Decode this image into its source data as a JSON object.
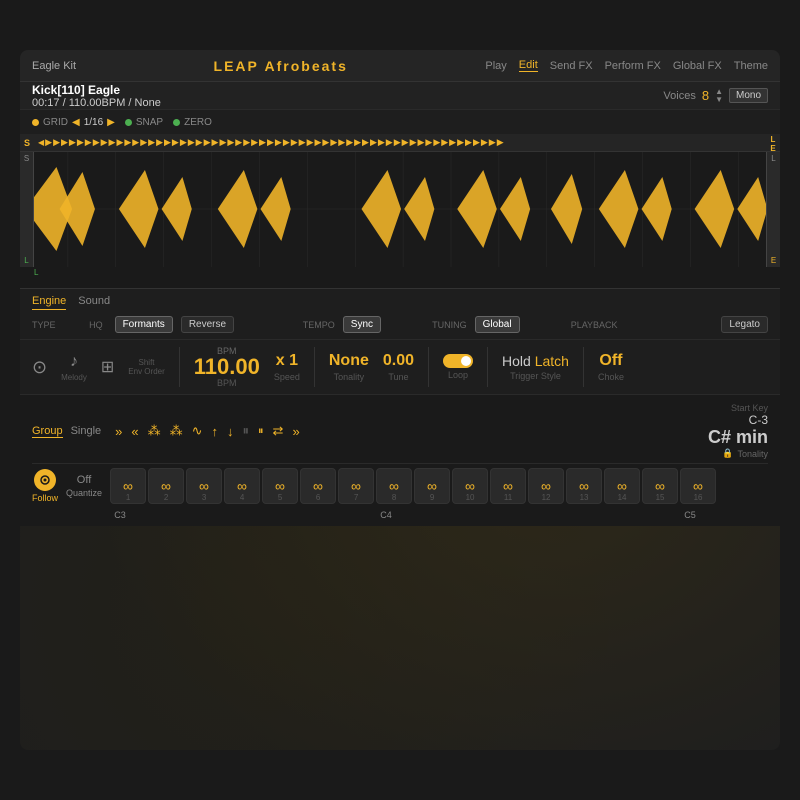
{
  "app": {
    "title_leap": "LEAP",
    "title_preset": "Afrobeats",
    "kit_name": "Eagle Kit",
    "nav_tabs": [
      "Play",
      "Edit",
      "Send FX",
      "Perform FX",
      "Global FX",
      "Theme"
    ],
    "active_tab": "Edit"
  },
  "track": {
    "name": "Kick[110] Eagle",
    "time": "00:17",
    "bpm": "110.00BPM",
    "key": "None",
    "voices_label": "Voices",
    "voices_count": "8",
    "mono_label": "Mono"
  },
  "grid": {
    "grid_label": "GRID",
    "grid_value": "1/16",
    "snap_label": "SNAP",
    "zero_label": "ZERO"
  },
  "timeline": {
    "marker_s": "S",
    "marker_l": "L",
    "marker_e": "E"
  },
  "engine": {
    "tabs": [
      "Engine",
      "Sound"
    ],
    "active_tab": "Engine",
    "type_label": "TYPE",
    "hq_label": "HQ",
    "formants_label": "Formants",
    "reverse_label": "Reverse",
    "tempo_label": "TEMPO",
    "sync_label": "Sync",
    "tuning_label": "TUNING",
    "global_label": "Global",
    "playback_label": "PLAYBACK",
    "legato_label": "Legato"
  },
  "controls": {
    "melody_label": "Melody",
    "shift_label": "Shift",
    "env_order_label": "Env Order",
    "bpm_value": "110.00",
    "bpm_label": "BPM",
    "speed_value": "x 1",
    "speed_label": "Speed",
    "tonality_value": "None",
    "tonality_label": "Tonality",
    "tune_value": "0.00",
    "tune_label": "Tune",
    "loop_label": "Loop",
    "hold_label": "Hold",
    "latch_label": "Latch",
    "trigger_style_label": "Trigger Style",
    "choke_value": "Off",
    "choke_label": "Choke"
  },
  "sequencer": {
    "group_tabs": [
      "Group",
      "Single"
    ],
    "active_tab": "Group",
    "start_key_label": "Start Key",
    "start_key_value": "C-3",
    "tonality_value": "C# min",
    "tonality_label": "Tonality"
  },
  "pads": {
    "follow_label": "Follow",
    "quantize_label": "Quantize",
    "quantize_value": "Off",
    "items": [
      {
        "num": "1",
        "note": "C3",
        "active": false
      },
      {
        "num": "2",
        "note": "",
        "active": false
      },
      {
        "num": "3",
        "note": "",
        "active": false
      },
      {
        "num": "4",
        "note": "",
        "active": false
      },
      {
        "num": "5",
        "note": "",
        "active": false
      },
      {
        "num": "6",
        "note": "",
        "active": false
      },
      {
        "num": "7",
        "note": "",
        "active": false
      },
      {
        "num": "8",
        "note": "C4",
        "active": false
      },
      {
        "num": "9",
        "note": "",
        "active": false
      },
      {
        "num": "10",
        "note": "",
        "active": false
      },
      {
        "num": "11",
        "note": "",
        "active": false
      },
      {
        "num": "12",
        "note": "",
        "active": false
      },
      {
        "num": "13",
        "note": "",
        "active": false
      },
      {
        "num": "14",
        "note": "",
        "active": false
      },
      {
        "num": "15",
        "note": "",
        "active": false
      },
      {
        "num": "16",
        "note": "C5",
        "active": false
      }
    ]
  }
}
